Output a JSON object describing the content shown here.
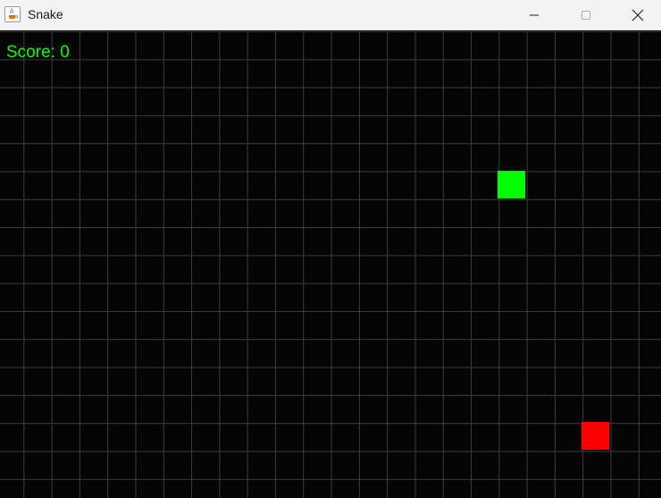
{
  "window": {
    "title": "Snake",
    "icon": "java-cup-icon"
  },
  "controls": [
    "minimize-icon",
    "maximize-icon",
    "close-icon"
  ],
  "game": {
    "score_text": "Score: 0",
    "grid": {
      "visible": true,
      "color": "#3c3c3c"
    },
    "background": "#040404",
    "snake": {
      "color": "#00ff00",
      "length": 1
    },
    "food": {
      "color": "#ff0000"
    },
    "score_color": "#00ff00"
  }
}
